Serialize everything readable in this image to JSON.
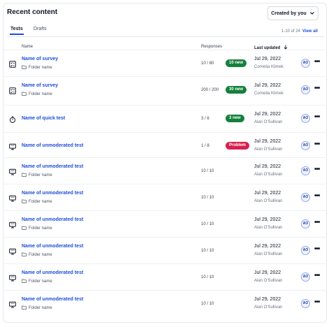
{
  "header": {
    "title": "Recent content",
    "filter_label": "Created by you"
  },
  "tabs": [
    {
      "label": "Tests"
    },
    {
      "label": "Drafts"
    }
  ],
  "pagination": {
    "range": "1-10 of 24",
    "view_all": "View all"
  },
  "columns": {
    "name": "Name",
    "responses": "Responses",
    "last_updated": "Last updated"
  },
  "rows": [
    {
      "icon": "survey-icon",
      "name": "Name of survey",
      "folder": "Folder name",
      "responses": "10 / 80",
      "badge": "10 new",
      "badge_type": "green",
      "date": "Jul 29, 2022",
      "author": "Cornelia Klimek",
      "avatar": "AO"
    },
    {
      "icon": "survey-icon",
      "name": "Name of survey",
      "folder": "Folder name",
      "responses": "200 / 200",
      "badge": "30 new",
      "badge_type": "green",
      "date": "Jul 29, 2022",
      "author": "Cornelia Klimek",
      "avatar": "AO"
    },
    {
      "icon": "stopwatch-icon",
      "name": "Name of quick test",
      "folder": "",
      "responses": "3 / 6",
      "badge": "3 new",
      "badge_type": "green",
      "date": "Jul 29, 2022",
      "author": "Alan O'Sullivan",
      "avatar": "AO"
    },
    {
      "icon": "monitor-icon",
      "name": "Name of unmoderated test",
      "folder": "",
      "responses": "1 / 8",
      "badge": "Problem",
      "badge_type": "red",
      "date": "Jul 29, 2022",
      "author": "Alan O'Sullivan",
      "avatar": "AO"
    },
    {
      "icon": "monitor-icon",
      "name": "Name of unmoderated test",
      "folder": "Folder name",
      "responses": "10 / 10",
      "badge": "",
      "badge_type": "",
      "date": "Jul 29, 2022",
      "author": "Alan O'Sullivan",
      "avatar": "AO"
    },
    {
      "icon": "monitor-icon",
      "name": "Name of unmoderated test",
      "folder": "Folder name",
      "responses": "10 / 10",
      "badge": "",
      "badge_type": "",
      "date": "Jul 29, 2022",
      "author": "Alan O'Sullivan",
      "avatar": "AO"
    },
    {
      "icon": "monitor-icon",
      "name": "Name of unmoderated test",
      "folder": "Folder name",
      "responses": "10 / 10",
      "badge": "",
      "badge_type": "",
      "date": "Jul 29, 2022",
      "author": "Alan O'Sullivan",
      "avatar": "AO"
    },
    {
      "icon": "monitor-icon",
      "name": "Name of unmoderated test",
      "folder": "Folder name",
      "responses": "10 / 10",
      "badge": "",
      "badge_type": "",
      "date": "Jul 29, 2022",
      "author": "Alan O'Sullivan",
      "avatar": "AO"
    },
    {
      "icon": "monitor-icon",
      "name": "Name of unmoderated test",
      "folder": "Folder name",
      "responses": "10 / 10",
      "badge": "",
      "badge_type": "",
      "date": "Jul 29, 2022",
      "author": "Alan O'Sullivan",
      "avatar": "AO"
    },
    {
      "icon": "monitor-icon",
      "name": "Name of unmoderated test",
      "folder": "Folder name",
      "responses": "10 / 10",
      "badge": "",
      "badge_type": "",
      "date": "Jul 29, 2022",
      "author": "Alan O'Sullivan",
      "avatar": "AO"
    }
  ],
  "colors": {
    "accent": "#1d4ed8",
    "badge_green": "#15803d",
    "badge_red": "#d6204e"
  }
}
